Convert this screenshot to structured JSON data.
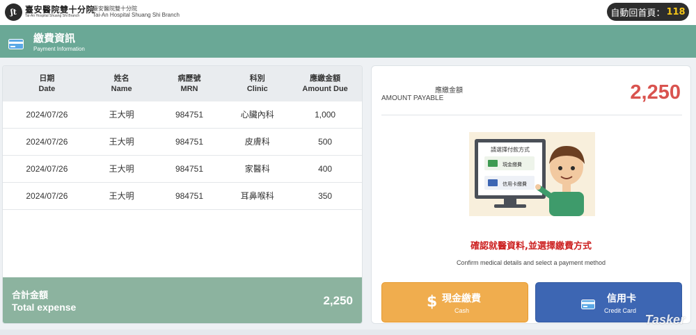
{
  "topbar": {
    "logo_mark": "ʃt",
    "logo_zh": "臺安醫院雙十分院",
    "logo_en": "Tai-An Hospital Shuang Shi Branch",
    "branch_zh": "臺安醫院雙十分院",
    "branch_en": "Tai-An Hospital Shuang Shi Branch",
    "countdown_label": "自動回首頁：",
    "countdown_value": "118"
  },
  "header": {
    "title": "繳費資訊",
    "subtitle": "Payment Information",
    "icon": "credit-card-icon"
  },
  "table": {
    "headers": [
      {
        "zh": "日期",
        "en": "Date"
      },
      {
        "zh": "姓名",
        "en": "Name"
      },
      {
        "zh": "病歷號",
        "en": "MRN"
      },
      {
        "zh": "科別",
        "en": "Clinic"
      },
      {
        "zh": "應繳金額",
        "en": "Amount Due"
      }
    ],
    "rows": [
      {
        "date": "2024/07/26",
        "name": "王大明",
        "mrn": "984751",
        "clinic": "心臟內科",
        "amount": "1,000"
      },
      {
        "date": "2024/07/26",
        "name": "王大明",
        "mrn": "984751",
        "clinic": "皮膚科",
        "amount": "500"
      },
      {
        "date": "2024/07/26",
        "name": "王大明",
        "mrn": "984751",
        "clinic": "家醫科",
        "amount": "400"
      },
      {
        "date": "2024/07/26",
        "name": "王大明",
        "mrn": "984751",
        "clinic": "耳鼻喉科",
        "amount": "350"
      }
    ],
    "footer": {
      "label_zh": "合計金額",
      "label_en": "Total expense",
      "total": "2,250"
    }
  },
  "payment": {
    "amount_label_zh": "應繳金額",
    "amount_label_en": "AMOUNT PAYABLE",
    "amount_value": "2,250",
    "illustration": {
      "screen_title": "請選擇付款方式",
      "option_cash": "現金繳費",
      "option_card": "信用卡繳費"
    },
    "confirm_zh": "確認就醫資料,並選擇繳費方式",
    "confirm_en": "Confirm medical details and select a payment method",
    "cash_button": {
      "zh": "現金繳費",
      "en": "Cash",
      "icon": "dollar-icon"
    },
    "card_button": {
      "zh": "信用卡",
      "en": "Credit Card",
      "icon": "credit-card-icon"
    }
  },
  "watermark": "Tasker",
  "colors": {
    "header_bg": "#6aa896",
    "footer_bg": "#8cb39f",
    "amount_red": "#d9534f",
    "cash_btn": "#f0ad4e",
    "card_btn": "#3d66b3",
    "countdown_accent": "#f5c518"
  }
}
